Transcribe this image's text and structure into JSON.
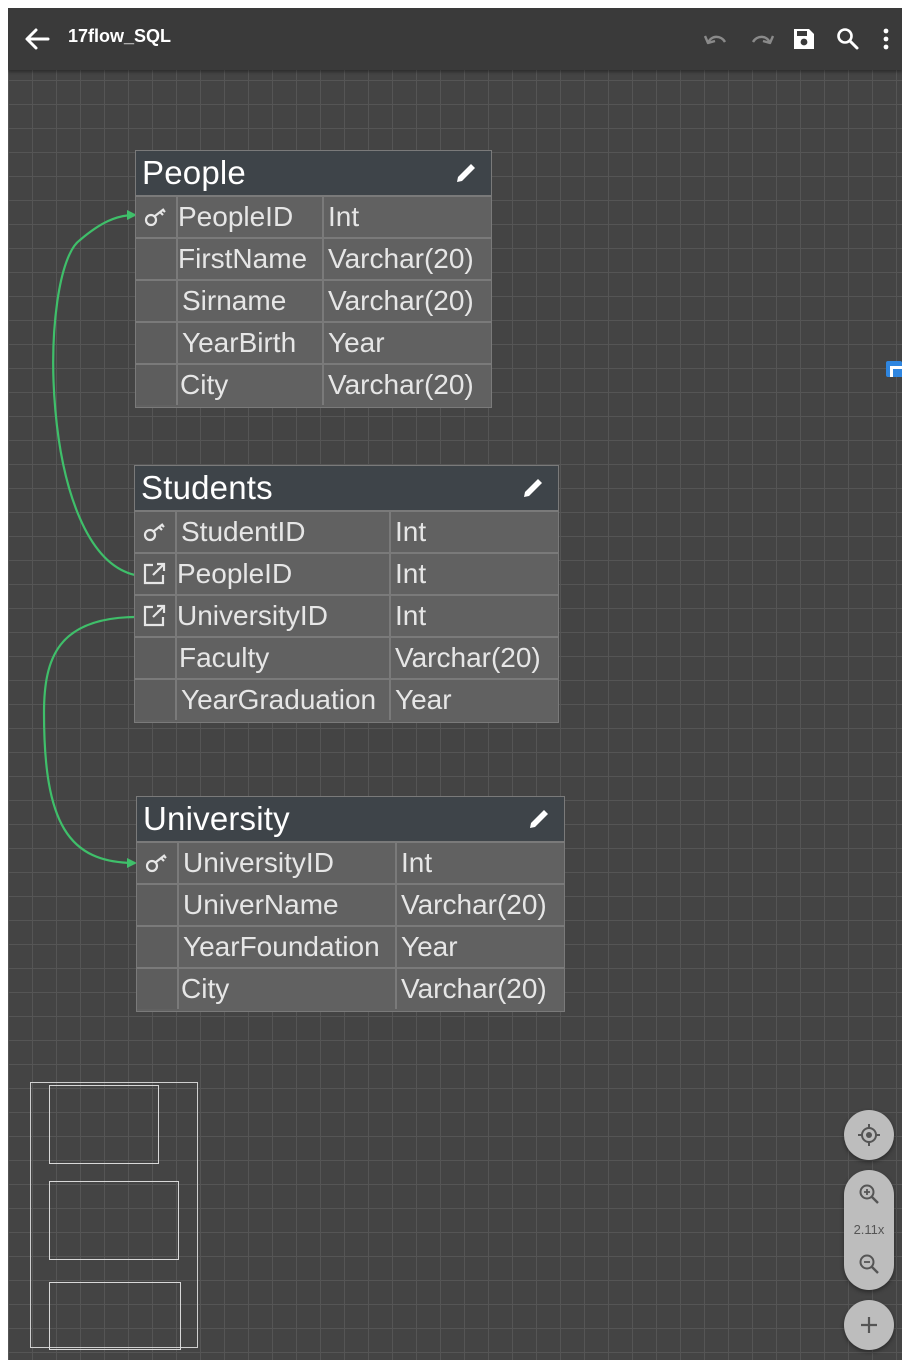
{
  "toolbar": {
    "title": "17flow_SQL",
    "icons": [
      "arrow-back-icon",
      "undo-icon",
      "redo-icon",
      "save-icon",
      "search-icon",
      "more-vert-icon"
    ]
  },
  "colors": {
    "canvas": "#444444",
    "grid": "#555555",
    "table_body": "#616161",
    "table_header": "#3e4449",
    "relation_line": "#3fbf6a"
  },
  "tables": [
    {
      "name": "People",
      "columns": [
        {
          "name": "PeopleID",
          "type": "Int",
          "key": "primary-key"
        },
        {
          "name": "FirstName",
          "type": "Varchar(20)",
          "key": ""
        },
        {
          "name": "Sirname",
          "type": "Varchar(20)",
          "key": ""
        },
        {
          "name": "YearBirth",
          "type": "Year",
          "key": ""
        },
        {
          "name": "City",
          "type": "Varchar(20)",
          "key": ""
        }
      ]
    },
    {
      "name": "Students",
      "columns": [
        {
          "name": "StudentID",
          "type": "Int",
          "key": "primary-key"
        },
        {
          "name": "PeopleID",
          "type": "Int",
          "key": "foreign-key"
        },
        {
          "name": "UniversityID",
          "type": "Int",
          "key": "foreign-key"
        },
        {
          "name": "Faculty",
          "type": "Varchar(20)",
          "key": ""
        },
        {
          "name": "YearGraduation",
          "type": "Year",
          "key": ""
        }
      ]
    },
    {
      "name": "University",
      "columns": [
        {
          "name": "UniversityID",
          "type": "Int",
          "key": "primary-key"
        },
        {
          "name": "UniverName",
          "type": "Varchar(20)",
          "key": ""
        },
        {
          "name": "YearFoundation",
          "type": "Year",
          "key": ""
        },
        {
          "name": "City",
          "type": "Varchar(20)",
          "key": ""
        }
      ]
    }
  ],
  "relations": [
    {
      "from": "Students.PeopleID",
      "to": "People.PeopleID"
    },
    {
      "from": "Students.UniversityID",
      "to": "University.UniversityID"
    }
  ],
  "zoom": {
    "level": "2.11x",
    "icons": [
      "my-location-icon",
      "zoom-in-icon",
      "zoom-out-icon",
      "add-icon"
    ]
  }
}
